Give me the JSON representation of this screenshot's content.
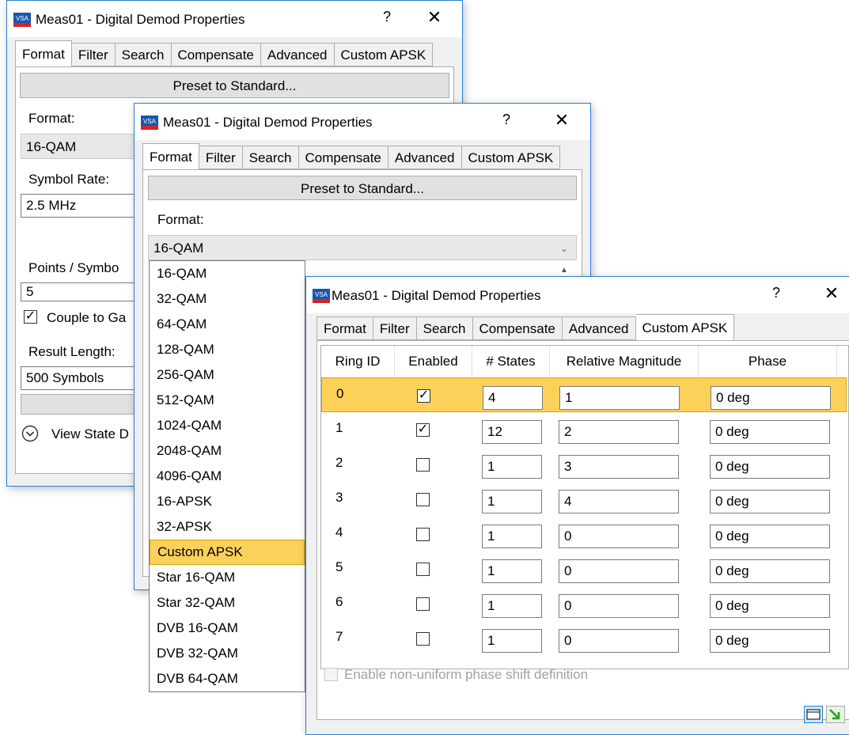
{
  "window1": {
    "title": "Meas01 - Digital Demod Properties",
    "help": "?",
    "close": "✕",
    "tabs": [
      "Format",
      "Filter",
      "Search",
      "Compensate",
      "Advanced",
      "Custom APSK"
    ],
    "preset_button": "Preset to Standard...",
    "format_label": "Format:",
    "format_value": "16-QAM",
    "symbol_rate_label": "Symbol Rate:",
    "symbol_rate_value": "2.5 MHz",
    "points_label": "Points / Symbo",
    "points_value": "5",
    "couple_label": "Couple to Ga",
    "result_length_label": "Result Length:",
    "result_length_value": "500 Symbols",
    "view_state_label": "View State D"
  },
  "window2": {
    "title": "Meas01 - Digital Demod Properties",
    "help": "?",
    "close": "✕",
    "tabs": [
      "Format",
      "Filter",
      "Search",
      "Compensate",
      "Advanced",
      "Custom APSK"
    ],
    "preset_button": "Preset to Standard...",
    "format_label": "Format:",
    "format_value": "16-QAM",
    "dropdown_items": [
      "16-QAM",
      "32-QAM",
      "64-QAM",
      "128-QAM",
      "256-QAM",
      "512-QAM",
      "1024-QAM",
      "2048-QAM",
      "4096-QAM",
      "16-APSK",
      "32-APSK",
      "Custom APSK",
      "Star 16-QAM",
      "Star 32-QAM",
      "DVB 16-QAM",
      "DVB 32-QAM",
      "DVB 64-QAM"
    ],
    "dropdown_selected": "Custom APSK"
  },
  "window3": {
    "title": "Meas01 - Digital Demod Properties",
    "help": "?",
    "close": "✕",
    "tabs": [
      "Format",
      "Filter",
      "Search",
      "Compensate",
      "Advanced",
      "Custom APSK"
    ],
    "active_tab": "Custom APSK",
    "columns": [
      "Ring ID",
      "Enabled",
      "# States",
      "Relative Magnitude",
      "Phase"
    ],
    "rows": [
      {
        "id": "0",
        "enabled": true,
        "states": "4",
        "magnitude": "1",
        "phase": "0 deg"
      },
      {
        "id": "1",
        "enabled": true,
        "states": "12",
        "magnitude": "2",
        "phase": "0 deg"
      },
      {
        "id": "2",
        "enabled": false,
        "states": "1",
        "magnitude": "3",
        "phase": "0 deg"
      },
      {
        "id": "3",
        "enabled": false,
        "states": "1",
        "magnitude": "4",
        "phase": "0 deg"
      },
      {
        "id": "4",
        "enabled": false,
        "states": "1",
        "magnitude": "0",
        "phase": "0 deg"
      },
      {
        "id": "5",
        "enabled": false,
        "states": "1",
        "magnitude": "0",
        "phase": "0 deg"
      },
      {
        "id": "6",
        "enabled": false,
        "states": "1",
        "magnitude": "0",
        "phase": "0 deg"
      },
      {
        "id": "7",
        "enabled": false,
        "states": "1",
        "magnitude": "0",
        "phase": "0 deg"
      }
    ],
    "nonuniform_label": "Enable non-uniform phase shift definition"
  },
  "colors": {
    "accent_border": "#2b7fd4",
    "selection": "#fcd15a",
    "selection_border": "#d9a300",
    "vsa_icon_blue": "#1a56b0",
    "vsa_icon_red": "#d62424"
  }
}
